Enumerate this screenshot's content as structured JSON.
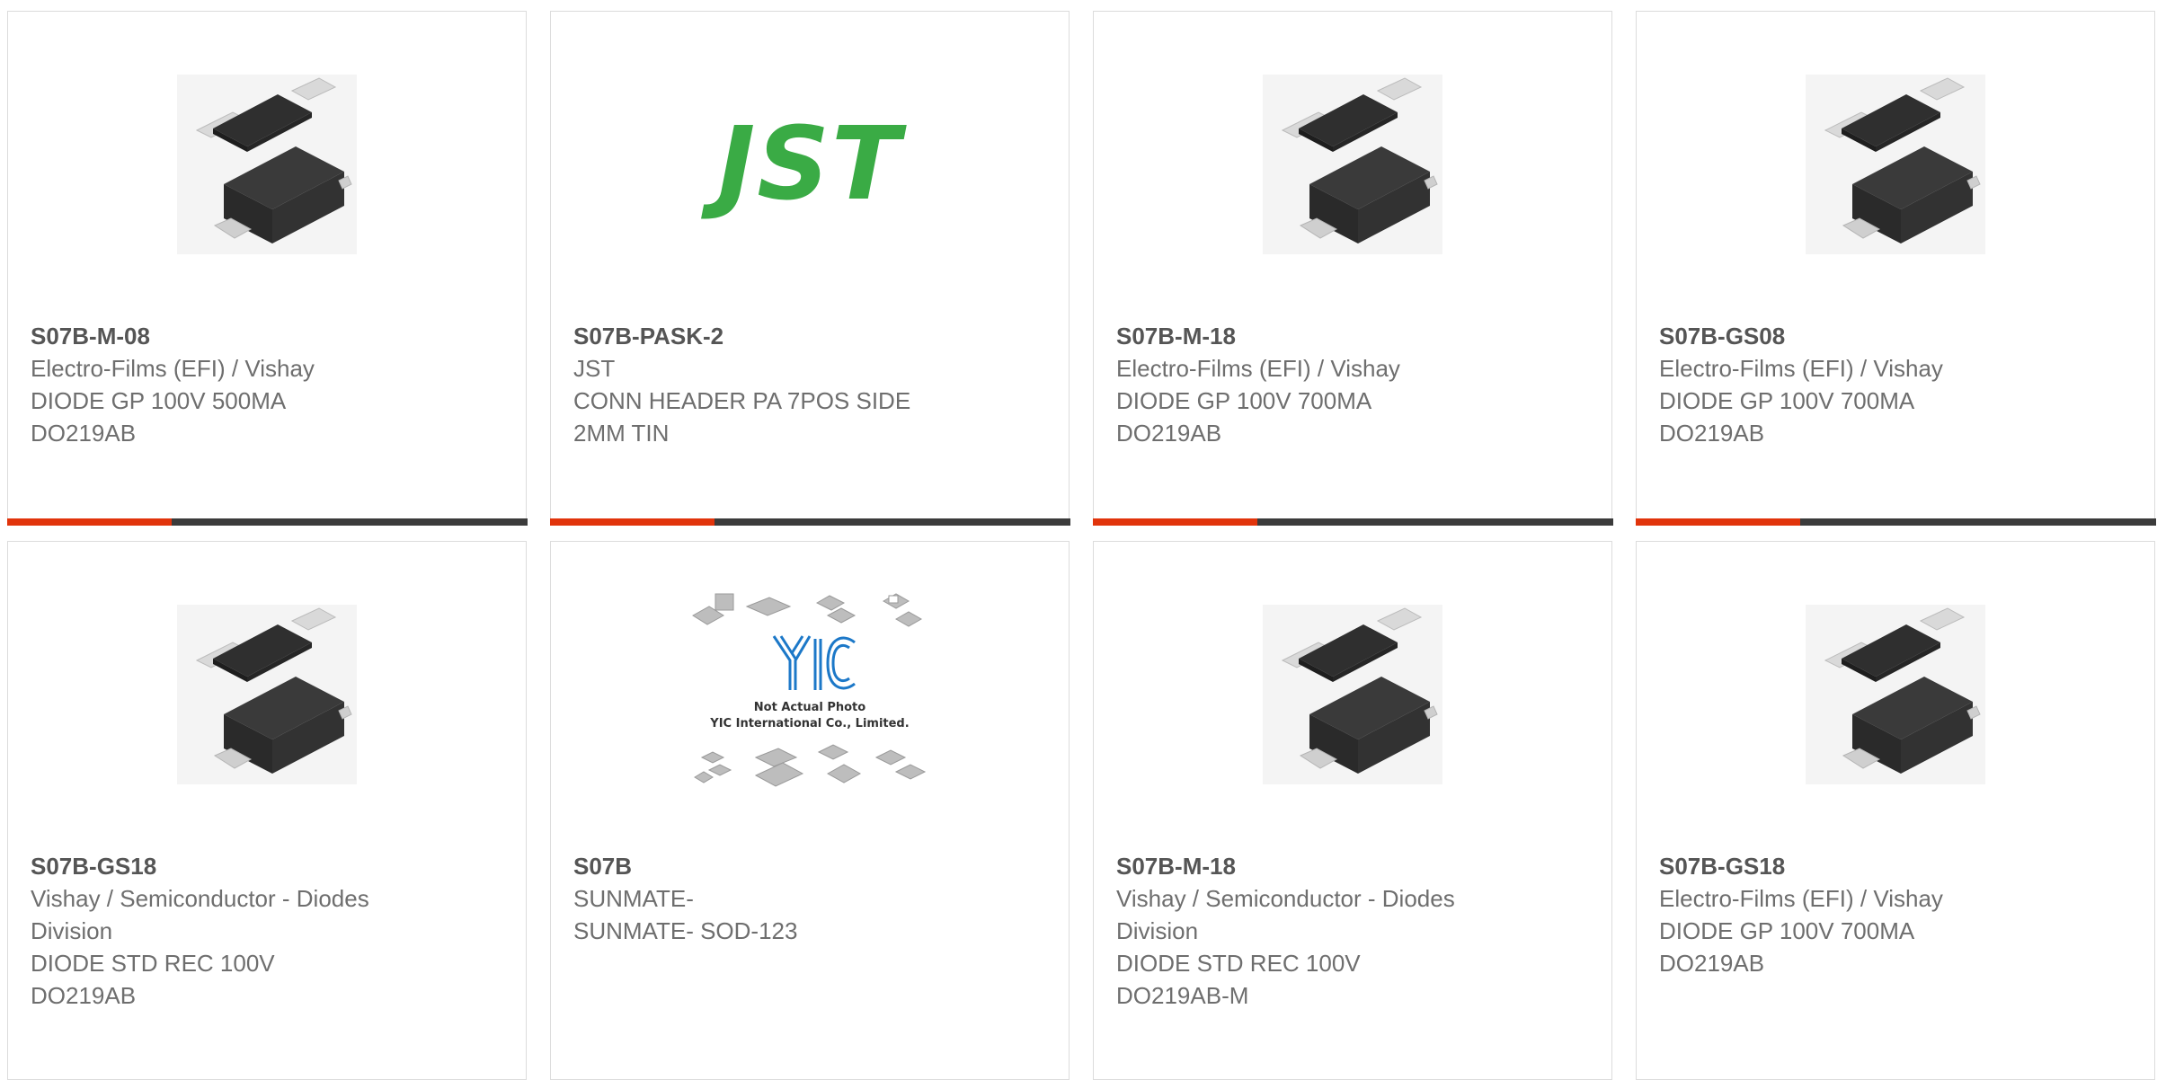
{
  "products": [
    {
      "part": "S07B-M-08",
      "lines": [
        "Electro-Films (EFI) / Vishay",
        "DIODE GP 100V 500MA",
        "DO219AB"
      ],
      "image": "diode-package-photo"
    },
    {
      "part": "S07B-PASK-2",
      "lines": [
        "JST",
        "CONN HEADER PA 7POS SIDE",
        "2MM TIN"
      ],
      "image": "jst-logo",
      "logo_text": "JST"
    },
    {
      "part": "S07B-M-18",
      "lines": [
        "Electro-Films (EFI) / Vishay",
        "DIODE GP 100V 700MA",
        "DO219AB"
      ],
      "image": "diode-package-photo"
    },
    {
      "part": "S07B-GS08",
      "lines": [
        "Electro-Films (EFI) / Vishay",
        "DIODE GP 100V 700MA",
        "DO219AB"
      ],
      "image": "diode-package-photo"
    },
    {
      "part": "S07B-GS18",
      "lines": [
        "Vishay / Semiconductor - Diodes",
        "Division",
        "DIODE STD REC 100V",
        "DO219AB"
      ],
      "image": "diode-package-photo"
    },
    {
      "part": "S07B",
      "lines": [
        "SUNMATE-",
        "SUNMATE- SOD-123"
      ],
      "image": "yic-placeholder",
      "placeholder_caption": [
        "Not Actual Photo",
        "YIC International Co., Limited."
      ]
    },
    {
      "part": "S07B-M-18",
      "lines": [
        "Vishay / Semiconductor - Diodes",
        "Division",
        "DIODE STD REC 100V",
        "DO219AB-M"
      ],
      "image": "diode-package-photo"
    },
    {
      "part": "S07B-GS18",
      "lines": [
        "Electro-Films (EFI) / Vishay",
        "DIODE GP 100V 700MA",
        "DO219AB"
      ],
      "image": "diode-package-photo"
    }
  ],
  "colors": {
    "accent": "#e1340b",
    "bar": "#3b3b3b",
    "jst_green": "#3aab45"
  }
}
